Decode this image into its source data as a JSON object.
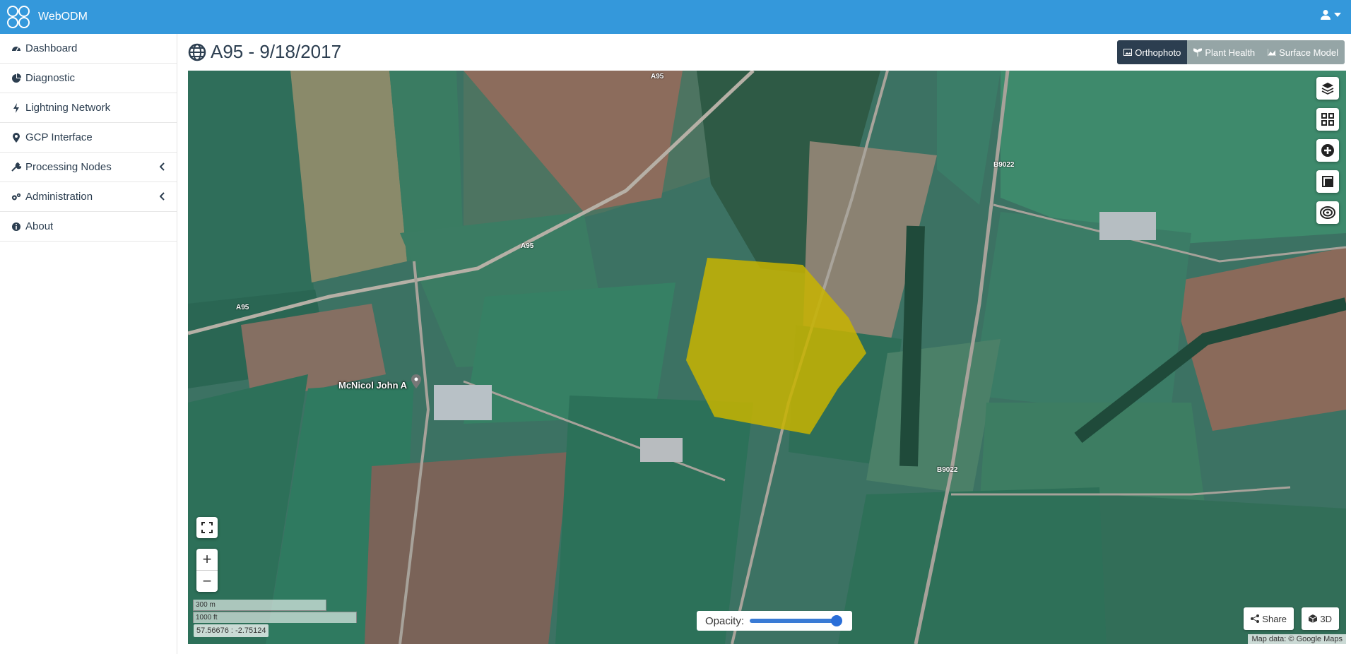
{
  "app": {
    "brand": "WebODM"
  },
  "sidebar": {
    "items": [
      {
        "label": "Dashboard",
        "icon": "dashboard-icon"
      },
      {
        "label": "Diagnostic",
        "icon": "pie-chart-icon"
      },
      {
        "label": "Lightning Network",
        "icon": "bolt-icon"
      },
      {
        "label": "GCP Interface",
        "icon": "map-marker-icon"
      },
      {
        "label": "Processing Nodes",
        "icon": "wrench-icon"
      },
      {
        "label": "Administration",
        "icon": "cogs-icon"
      },
      {
        "label": "About",
        "icon": "info-icon"
      }
    ]
  },
  "page": {
    "title": "A95 - 9/18/2017"
  },
  "view_tabs": [
    {
      "label": "Orthophoto",
      "active": true
    },
    {
      "label": "Plant Health",
      "active": false
    },
    {
      "label": "Surface Model",
      "active": false
    }
  ],
  "map": {
    "place_label": "McNicol John A",
    "road_labels": [
      "A95",
      "A95",
      "A95",
      "B9022",
      "B9022"
    ],
    "scale_metric": "300 m",
    "scale_imperial": "1000 ft",
    "coordinates": "57.56676 : -2.75124",
    "opacity_label": "Opacity:",
    "opacity_value": 0.95,
    "share_label": "Share",
    "three_d_label": "3D",
    "attribution": "Map data: © Google Maps",
    "colors": {
      "accent": "#3498db",
      "overlay": "#c8b400"
    }
  }
}
